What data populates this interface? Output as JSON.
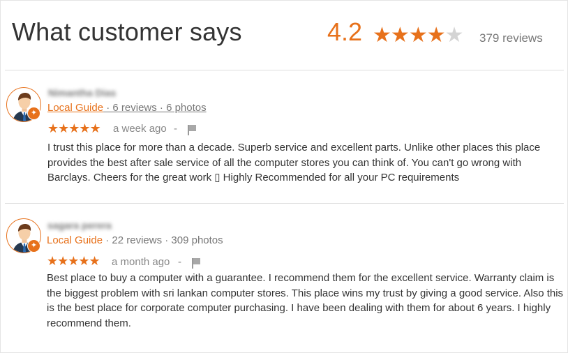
{
  "header": {
    "title": "What customer says",
    "rating": "4.2",
    "stars_filled": 4,
    "stars_total": 5,
    "review_count": "379 reviews"
  },
  "reviews": [
    {
      "reviewer_name": "Nimantha Dias",
      "guide_label": "Local Guide",
      "guide_stats": " · 6 reviews · 6 photos",
      "stars": "★★★★★",
      "time": "a week ago",
      "dash": "-",
      "text": "I trust this place for more than a decade. Superb service and excellent parts. Unlike other places this place provides the best after sale service of all the computer stores you can think of. You can't go wrong with Barclays. Cheers for the great work ▯ Highly Recommended for all your PC requirements"
    },
    {
      "reviewer_name": "sagara perera",
      "guide_label": "Local Guide",
      "guide_stats": " · 22 reviews · 309 photos",
      "stars": "★★★★★",
      "time": "a month ago",
      "dash": "-",
      "text": "Best place to buy a computer with a guarantee. I recommend them for the excellent service.  Warranty claim is the biggest problem with sri lankan computer stores.  This place wins my trust by giving a good service.  Also this is the best place for corporate computer purchasing. I have been dealing with them for about 6 years. I highly recommend them."
    }
  ],
  "icons": {
    "avatar": "businessman-avatar-icon",
    "badge": "local-guide-badge-icon",
    "flag": "flag-icon"
  },
  "colors": {
    "accent": "#e7711b",
    "text": "#333333",
    "muted": "#777777",
    "star_empty": "#d4d4d4"
  }
}
